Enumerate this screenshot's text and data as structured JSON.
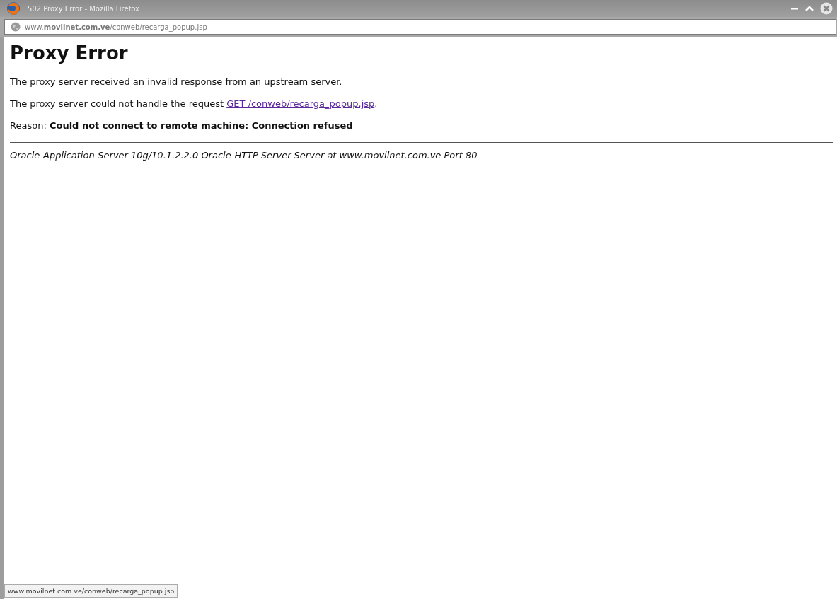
{
  "window": {
    "title": "502 Proxy Error - Mozilla Firefox"
  },
  "address_bar": {
    "url": "www.**movilnet.com.ve**/conweb/recarga_popup.jsp"
  },
  "page": {
    "heading": "Proxy Error",
    "paragraph_1": "The proxy server received an invalid response from an upstream server.",
    "paragraph_2": {
      "before": "The proxy server could not handle the request ",
      "link": "GET /conweb/recarga_popup.jsp",
      "after": "."
    },
    "reason": "Reason: **Could not connect to remote machine: Connection refused**",
    "footer": "Oracle-Application-Server-10g/10.1.2.2.0 Oracle-HTTP-Server Server at www.movilnet.com.ve Port 80"
  },
  "status_bar": {
    "link_url": "www.movilnet.com.ve/conweb/recarga_popup.jsp"
  }
}
